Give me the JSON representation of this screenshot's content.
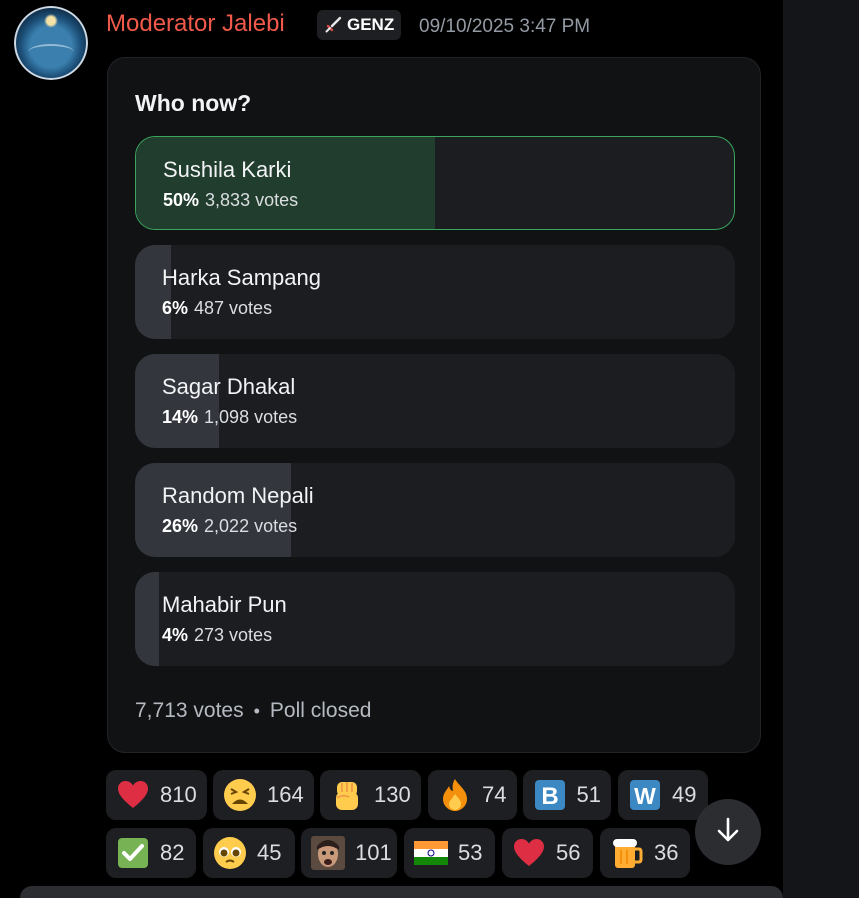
{
  "message": {
    "author": "Moderator Jalebi",
    "tag": "GENZ",
    "timestamp": "09/10/2025 3:47 PM",
    "author_color": "#f15a4a"
  },
  "poll": {
    "question": "Who now?",
    "options": [
      {
        "label": "Sushila Karki",
        "percent": "50%",
        "votes": "3,833 votes",
        "fraction": 0.5,
        "winner": true
      },
      {
        "label": "Harka Sampang",
        "percent": "6%",
        "votes": "487 votes",
        "fraction": 0.06,
        "winner": false
      },
      {
        "label": "Sagar Dhakal",
        "percent": "14%",
        "votes": "1,098 votes",
        "fraction": 0.14,
        "winner": false
      },
      {
        "label": "Random Nepali",
        "percent": "26%",
        "votes": "2,022 votes",
        "fraction": 0.26,
        "winner": false
      },
      {
        "label": "Mahabir Pun",
        "percent": "4%",
        "votes": "273 votes",
        "fraction": 0.04,
        "winner": false
      }
    ],
    "total_votes": "7,713 votes",
    "separator": "•",
    "status": "Poll closed"
  },
  "reactions": [
    {
      "emoji": "red-heart",
      "count": "810"
    },
    {
      "emoji": "tired-face",
      "count": "164"
    },
    {
      "emoji": "raised-fist",
      "count": "130"
    },
    {
      "emoji": "fire",
      "count": "74"
    },
    {
      "emoji": "letter-b",
      "count": "51"
    },
    {
      "emoji": "letter-w",
      "count": "49"
    },
    {
      "emoji": "check-mark",
      "count": "82"
    },
    {
      "emoji": "pleading-face",
      "count": "45"
    },
    {
      "emoji": "custom-face",
      "count": "101"
    },
    {
      "emoji": "india-flag",
      "count": "53"
    },
    {
      "emoji": "red-heart",
      "count": "56"
    },
    {
      "emoji": "beer-mug",
      "count": "36"
    }
  ],
  "colors": {
    "winner_border": "#3ba55c",
    "winner_fill": "#203d2e",
    "fill": "#33363d"
  }
}
